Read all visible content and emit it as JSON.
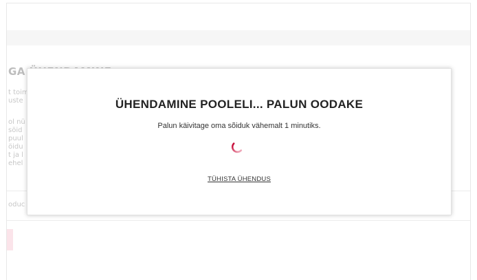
{
  "background": {
    "heading": "GA ÜHENDAMINE",
    "lines_group_1": [
      "t toim",
      "uste"
    ],
    "lines_group_2": [
      "ol nü",
      "söid",
      "puul",
      "öidu",
      "t ja l",
      "ehel"
    ],
    "footer_line": "oduc"
  },
  "modal": {
    "title": "ÜHENDAMINE POOLELI... PALUN OODAKE",
    "message": "Palun käivitage oma sõiduk vähemalt 1 minutiks.",
    "cancel_label": "TÜHISTA ÜHENDUS",
    "spinner_icon": "loading-spinner-icon",
    "accent_color": "#c3002f"
  }
}
